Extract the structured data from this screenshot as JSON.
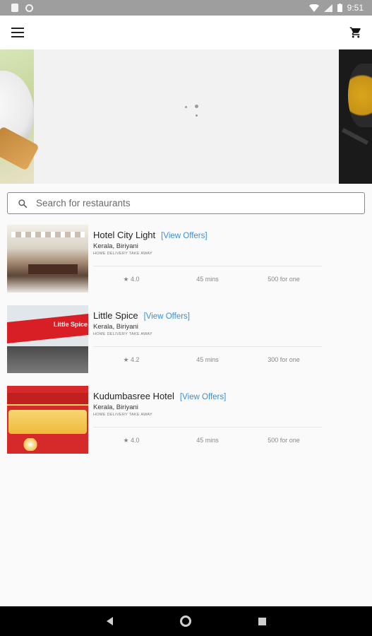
{
  "statusbar": {
    "time": "9:51"
  },
  "search": {
    "placeholder": "Search for restaurants"
  },
  "restaurants": [
    {
      "name": "Hotel City Light",
      "offers": "[View Offers]",
      "cuisine": "Kerala, Biriyani",
      "services": "HOME DELIVERY TAKE AWAY",
      "rating": "4.0",
      "time": "45 mins",
      "cost": "500 for one"
    },
    {
      "name": "Little Spice",
      "offers": "[View Offers]",
      "cuisine": "Kerala, Biriyani",
      "services": "HOME DELIVERY TAKE AWAY",
      "rating": "4.2",
      "time": "45 mins",
      "cost": "300 for one"
    },
    {
      "name": "Kudumbasree Hotel",
      "offers": "[View Offers]",
      "cuisine": "Kerala, Biriyani",
      "services": "HOME DELIVERY TAKE AWAY",
      "rating": "4.0",
      "time": "45 mins",
      "cost": "500 for one"
    }
  ],
  "thumbs": {
    "little_spice_sign": "Little Spice"
  }
}
